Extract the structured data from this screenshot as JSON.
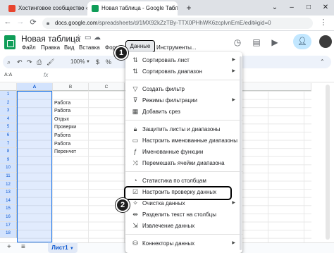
{
  "browser": {
    "tabs": [
      {
        "title": "Хостинговое сообщество «Тим",
        "active": false,
        "favicon_color": "#e8442e"
      },
      {
        "title": "Новая таблица - Google Табли",
        "active": true,
        "favicon_color": "#0f9d58"
      }
    ],
    "new_tab": "+",
    "url_host": "docs.google.com",
    "url_path": "/spreadsheets/d/1MX92kZzTBy-TTX0PHhWK6zcplvnEmE/edit#gid=0",
    "controls": {
      "back": "←",
      "forward": "→",
      "reload": "⟳",
      "minimize": "–",
      "maximize": "□",
      "close": "✕",
      "chevron": "⌄"
    }
  },
  "sheets": {
    "title": "Новая таблица",
    "menu": [
      "Файл",
      "Правка",
      "Вид",
      "Вставка",
      "Форм"
    ],
    "menu_active": "Данные",
    "menu_after": "Инструменты",
    "menu_more": "…",
    "toolbar": {
      "zoom": "100%"
    },
    "cell_ref": "A:A",
    "fx": "fx",
    "columns": [
      "A",
      "B",
      "C"
    ],
    "rows": [
      "1",
      "2",
      "3",
      "4",
      "5",
      "6",
      "7",
      "8",
      "9",
      "10",
      "11",
      "12",
      "13",
      "14",
      "15",
      "16",
      "17",
      "18"
    ],
    "column_b_values": [
      "Работа",
      "Работа",
      "Отдых",
      "Проверки",
      "Работа",
      "Работа",
      "Перенчет"
    ],
    "sheet_tab": "Лист1",
    "accent_color": "#1a73e8"
  },
  "data_menu": {
    "items": [
      {
        "icon": "sort-sheet-icon",
        "label": "Сортировать лист",
        "submenu": true
      },
      {
        "icon": "sort-range-icon",
        "label": "Сортировать диапазон",
        "submenu": true
      },
      {
        "icon": "filter-icon",
        "label": "Создать фильтр",
        "submenu": false
      },
      {
        "icon": "filter-views-icon",
        "label": "Режимы фильтрации",
        "submenu": true
      },
      {
        "icon": "slicer-icon",
        "label": "Добавить срез",
        "submenu": false
      },
      {
        "icon": "lock-icon",
        "label": "Защитить листы и диапазоны",
        "submenu": false
      },
      {
        "icon": "named-ranges-icon",
        "label": "Настроить именованные диапазоны",
        "submenu": false
      },
      {
        "icon": "named-functions-icon",
        "label": "Именованные функции",
        "submenu": false
      },
      {
        "icon": "randomize-icon",
        "label": "Перемешать ячейки диапазона",
        "submenu": false
      },
      {
        "icon": "column-stats-icon",
        "label": "Статистика по столбцам",
        "submenu": false
      },
      {
        "icon": "data-validation-icon",
        "label": "Настроить проверку данных",
        "submenu": false
      },
      {
        "icon": "data-cleanup-icon",
        "label": "Очистка данных",
        "submenu": true
      },
      {
        "icon": "split-text-icon",
        "label": "Разделить текст на столбцы",
        "submenu": false
      },
      {
        "icon": "data-extraction-icon",
        "label": "Извлечение данных",
        "submenu": false
      },
      {
        "icon": "data-connectors-icon",
        "label": "Коннекторы данных",
        "submenu": true
      }
    ]
  },
  "callouts": [
    "1",
    "2"
  ]
}
